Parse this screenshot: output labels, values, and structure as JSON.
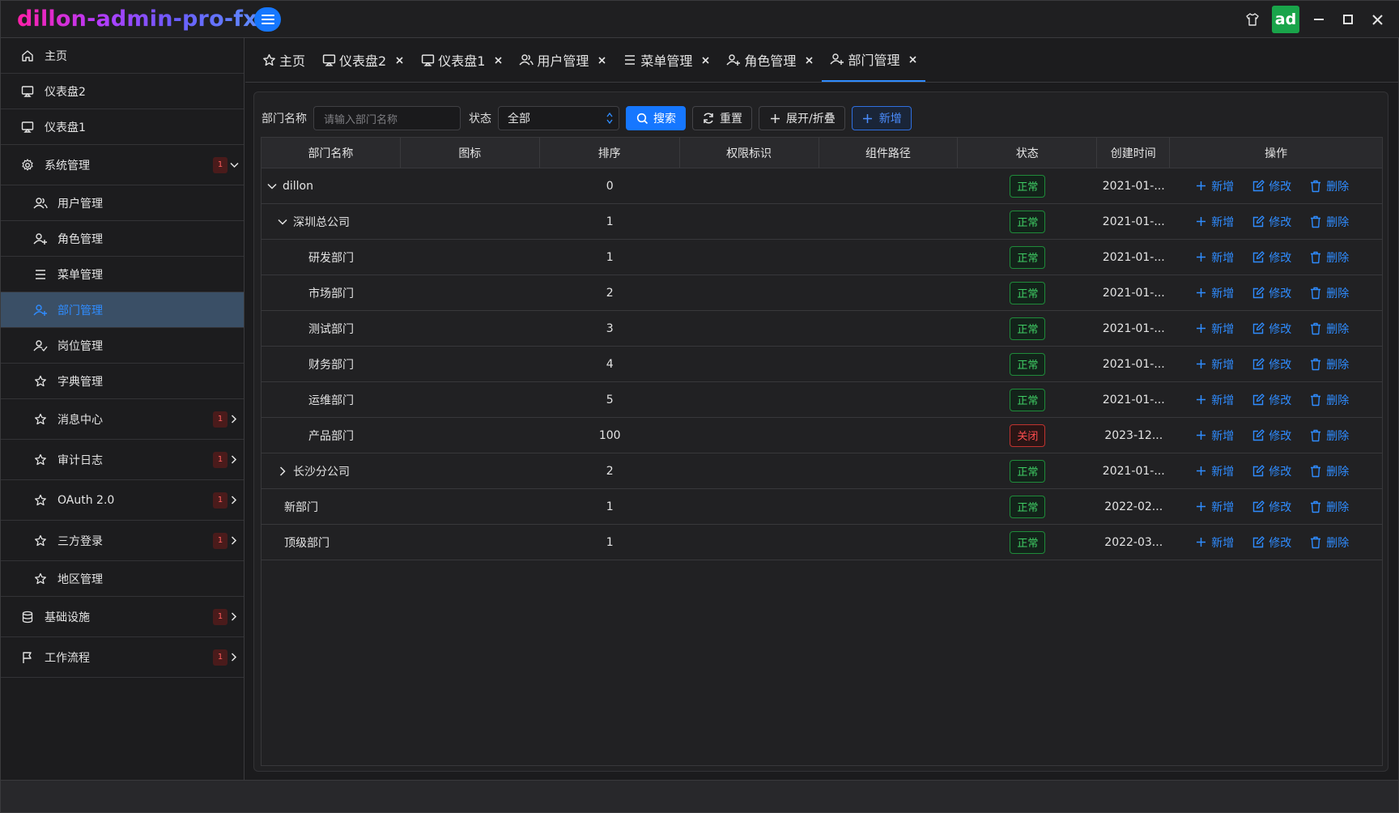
{
  "app": {
    "title": "dillon-admin-pro-fx",
    "avatar_text": "ad"
  },
  "sidebar": {
    "items": [
      {
        "label": "主页",
        "icon": "home-icon"
      },
      {
        "label": "仪表盘2",
        "icon": "monitor-icon"
      },
      {
        "label": "仪表盘1",
        "icon": "monitor-icon"
      },
      {
        "label": "系统管理",
        "icon": "gear-icon",
        "badge": "1",
        "expanded": true
      },
      {
        "label": "用户管理",
        "icon": "users-icon"
      },
      {
        "label": "角色管理",
        "icon": "user-plus-icon"
      },
      {
        "label": "菜单管理",
        "icon": "menu-icon"
      },
      {
        "label": "部门管理",
        "icon": "user-plus-icon",
        "active": true
      },
      {
        "label": "岗位管理",
        "icon": "user-check-icon"
      },
      {
        "label": "字典管理",
        "icon": "star-icon"
      },
      {
        "label": "消息中心",
        "icon": "star-icon",
        "badge": "1"
      },
      {
        "label": "审计日志",
        "icon": "star-icon",
        "badge": "1"
      },
      {
        "label": "OAuth 2.0",
        "icon": "star-icon",
        "badge": "1"
      },
      {
        "label": "三方登录",
        "icon": "star-icon",
        "badge": "1"
      },
      {
        "label": "地区管理",
        "icon": "star-icon"
      },
      {
        "label": "基础设施",
        "icon": "database-icon",
        "badge": "1"
      },
      {
        "label": "工作流程",
        "icon": "flag-icon",
        "badge": "1"
      }
    ]
  },
  "tabs": [
    {
      "label": "主页",
      "icon": "star-icon",
      "closable": false
    },
    {
      "label": "仪表盘2",
      "icon": "monitor-icon",
      "closable": true
    },
    {
      "label": "仪表盘1",
      "icon": "monitor-icon",
      "closable": true
    },
    {
      "label": "用户管理",
      "icon": "users-icon",
      "closable": true
    },
    {
      "label": "菜单管理",
      "icon": "menu-icon",
      "closable": true
    },
    {
      "label": "角色管理",
      "icon": "user-plus-icon",
      "closable": true
    },
    {
      "label": "部门管理",
      "icon": "user-plus-icon",
      "closable": true,
      "active": true
    }
  ],
  "search": {
    "name_label": "部门名称",
    "name_placeholder": "请输入部门名称",
    "status_label": "状态",
    "status_value": "全部",
    "search_btn": "搜索",
    "reset_btn": "重置",
    "toggle_btn": "展开/折叠",
    "add_btn": "新增"
  },
  "table": {
    "headers": [
      "部门名称",
      "图标",
      "排序",
      "权限标识",
      "组件路径",
      "状态",
      "创建时间",
      "操作"
    ],
    "rows": [
      {
        "name": "dillon",
        "level": 0,
        "arrow": "down",
        "sort": "0",
        "status": "正常",
        "created": "2021-01-..."
      },
      {
        "name": "深圳总公司",
        "level": 1,
        "arrow": "down",
        "sort": "1",
        "status": "正常",
        "created": "2021-01-..."
      },
      {
        "name": "研发部门",
        "level": 2,
        "arrow": "",
        "sort": "1",
        "status": "正常",
        "created": "2021-01-..."
      },
      {
        "name": "市场部门",
        "level": 2,
        "arrow": "",
        "sort": "2",
        "status": "正常",
        "created": "2021-01-..."
      },
      {
        "name": "测试部门",
        "level": 2,
        "arrow": "",
        "sort": "3",
        "status": "正常",
        "created": "2021-01-..."
      },
      {
        "name": "财务部门",
        "level": 2,
        "arrow": "",
        "sort": "4",
        "status": "正常",
        "created": "2021-01-..."
      },
      {
        "name": "运维部门",
        "level": 2,
        "arrow": "",
        "sort": "5",
        "status": "正常",
        "created": "2021-01-..."
      },
      {
        "name": "产品部门",
        "level": 2,
        "arrow": "",
        "sort": "100",
        "status": "关闭",
        "created": "2023-12..."
      },
      {
        "name": "长沙分公司",
        "level": 1,
        "arrow": "right",
        "sort": "2",
        "status": "正常",
        "created": "2021-01-..."
      },
      {
        "name": "新部门",
        "level": 0,
        "arrow": "",
        "sort": "1",
        "status": "正常",
        "created": "2022-02..."
      },
      {
        "name": "顶级部门",
        "level": 0,
        "arrow": "",
        "sort": "1",
        "status": "正常",
        "created": "2022-03..."
      }
    ],
    "ops": {
      "add": "新增",
      "edit": "修改",
      "delete": "删除"
    }
  },
  "colors": {
    "accent": "#1677ff",
    "ok": "#3fce64",
    "danger": "#ff4d4f",
    "active_bg": "#3a4f66"
  }
}
